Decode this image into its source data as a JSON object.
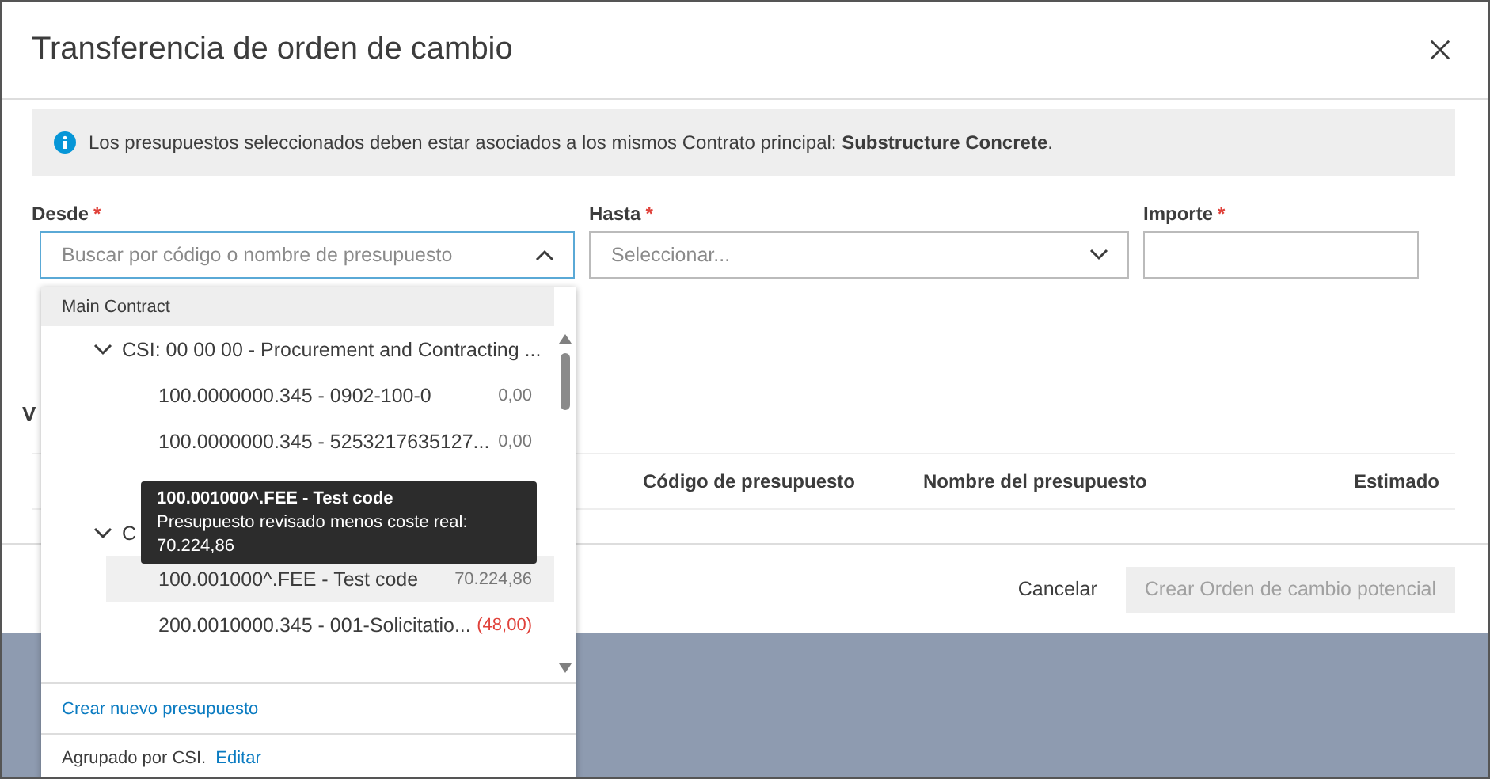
{
  "dialog": {
    "title": "Transferencia de orden de cambio",
    "info": "Los presupuestos seleccionados deben estar asociados a los mismos Contrato principal: **Substructure Concrete**.",
    "fields": [
      {
        "label": "Desde",
        "required_mark": "*",
        "kind": "search",
        "placeholder": "Buscar por código o nombre de presupuesto",
        "expanded": true
      },
      {
        "label": "Hasta",
        "required_mark": "*",
        "kind": "select",
        "placeholder": "Seleccionar...",
        "expanded": false
      },
      {
        "label": "Importe",
        "required_mark": "*",
        "kind": "text"
      }
    ],
    "section_title": "V",
    "table": {
      "columns": [
        "Código de presupuesto",
        "Nombre del presupuesto",
        "Estimado"
      ]
    },
    "buttons": [
      {
        "label": "Cancelar",
        "kind": "link",
        "disabled": false
      },
      {
        "label": "Crear Orden de cambio potencial",
        "kind": "primary",
        "disabled": true
      }
    ]
  },
  "dropdown": {
    "group": "Main Contract",
    "tree": [
      {
        "label": "CSI: 00 00 00 - Procurement and Contracting ...",
        "expanded": true,
        "children": [
          {
            "kind": "item",
            "label": "100.0000000.345 - 0902-100-0",
            "value": "0,00",
            "negative": false,
            "hovered": false
          },
          {
            "kind": "item",
            "label": "100.0000000.345 - 5253217635127...",
            "value": "0,00",
            "negative": false,
            "hovered": false
          },
          {
            "kind": "covered"
          }
        ]
      },
      {
        "label": "C",
        "expanded": true,
        "children": [
          {
            "kind": "item",
            "label": "100.001000^.FEE - Test code",
            "value": "70.224,86",
            "negative": false,
            "hovered": true
          },
          {
            "kind": "item",
            "label": "200.0010000.345 - 001-Solicitatio...",
            "value": "(48,00)",
            "negative": true,
            "hovered": false
          },
          {
            "kind": "covered"
          }
        ]
      }
    ],
    "tooltip": {
      "title": "100.001000^.FEE - Test code",
      "text": "Presupuesto revisado menos coste real:",
      "value": "70.224,86"
    },
    "create_link": "Crear nuevo presupuesto",
    "grouping": "Agrupado por CSI.",
    "edit_link": "Editar"
  }
}
